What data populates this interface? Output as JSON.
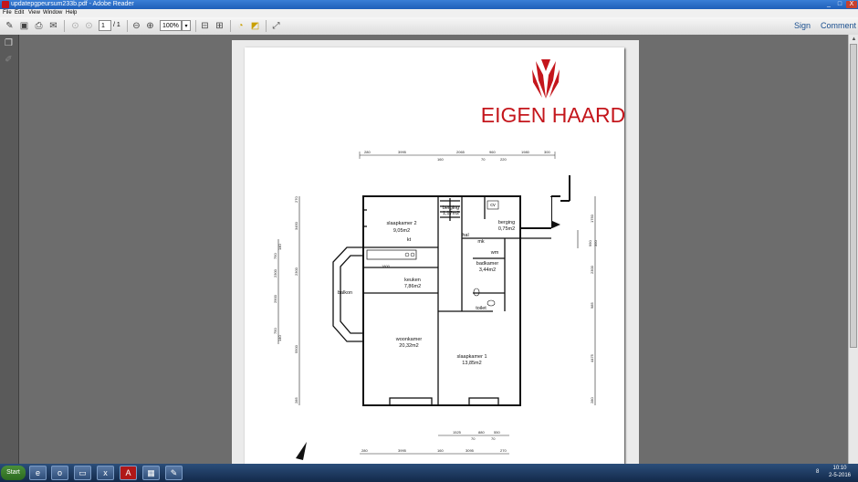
{
  "window": {
    "title": "updatepgpeursum233b.pdf - Adobe Reader",
    "minimize": "_",
    "maximize": "□",
    "close": "X"
  },
  "menu": [
    "File",
    "Edit",
    "View",
    "Window",
    "Help"
  ],
  "toolbar": {
    "page_current": "1",
    "page_total": "/ 1",
    "zoom": "100%",
    "sign": "Sign",
    "comment": "Comment"
  },
  "brand": {
    "logo_text": "EIGEN HAARD",
    "brand_red": "#c4161c"
  },
  "rooms": {
    "slaapkamer2": "slaapkamer 2",
    "slaapkamer2_area": "9,05m2",
    "berging1": "berging",
    "berging1_area": "1,17m2",
    "cv": "cv",
    "berging2": "berging",
    "berging2_area": "0,75m2",
    "hal": "hal",
    "mk": "mk",
    "kt": "kt",
    "wm": "wm",
    "badkamer": "badkamer",
    "badkamer_area": "3,44m2",
    "keuken": "keuken",
    "keuken_area": "7,86m2",
    "balkon": "balkon",
    "toilet": "toilet",
    "woonkamer": "woonkamer",
    "woonkamer_area": "20,32m2",
    "slaapkamer1": "slaapkamer 1",
    "slaapkamer1_area": "13,85m2"
  },
  "dims": {
    "top_row1": [
      "280",
      "3995",
      "2065",
      "960",
      "1980",
      "300"
    ],
    "top_row2": [
      "160",
      "70",
      "220"
    ],
    "kitchen_width": "1800",
    "bottom_row1": [
      "1525",
      "880",
      "550"
    ],
    "bottom_row2": [
      "70",
      "70"
    ],
    "bottom_row3": [
      "280",
      "3995",
      "160",
      "3095",
      "270"
    ],
    "left_outer": [
      "750",
      "2300",
      "2900",
      "750"
    ],
    "left_outer_small": [
      "140",
      "140"
    ],
    "left_inner": [
      "270",
      "3450",
      "2300",
      "5500",
      "285"
    ],
    "right_inner": [
      "1750",
      "2300",
      "985",
      "4475",
      "280"
    ],
    "right_small": [
      "990",
      "350"
    ]
  },
  "taskbar": {
    "start": "Start",
    "clock_time": "10:10",
    "clock_date": "2-5-2016",
    "tray_num": "8"
  }
}
